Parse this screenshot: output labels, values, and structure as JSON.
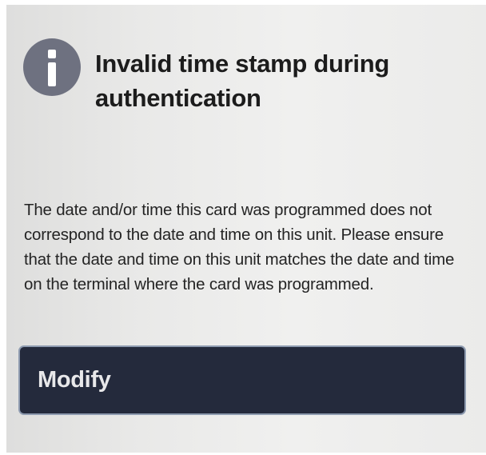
{
  "dialog": {
    "icon": "info-icon",
    "title": "Invalid time stamp during authentication",
    "message": "The date and/or time this card was programmed does not correspond to the date and time on this unit. Please ensure that the date and time on this unit matches the date and time on the terminal where the card was programmed.",
    "modify_label": "Modify"
  },
  "colors": {
    "icon_background": "#6e7180",
    "button_background": "#242a3c",
    "button_border": "#8e9bb0",
    "text": "#1c1c1c"
  }
}
